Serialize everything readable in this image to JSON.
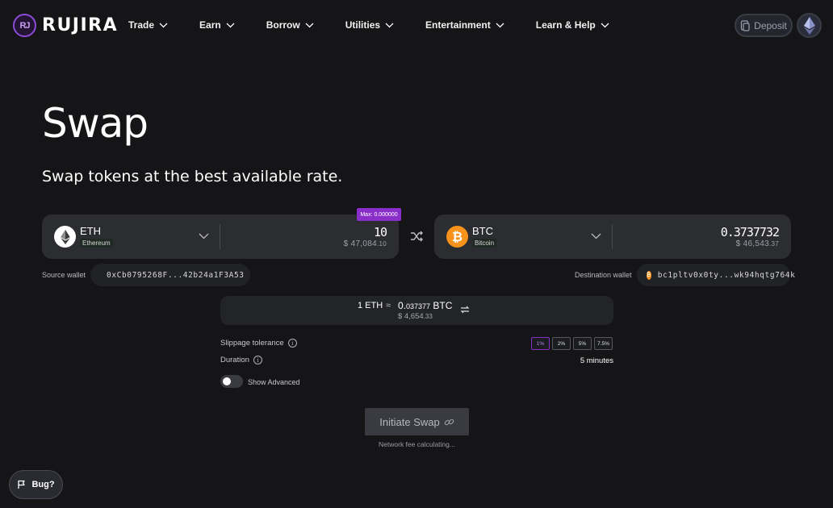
{
  "header": {
    "logo_text": "RUJIRA",
    "logo_mark": "RJ",
    "nav": [
      "Trade",
      "Earn",
      "Borrow",
      "Utilities",
      "Entertainment",
      "Learn & Help"
    ],
    "deposit_label": "Deposit"
  },
  "page": {
    "title": "Swap",
    "subtitle": "Swap tokens at the best available rate."
  },
  "source": {
    "symbol": "ETH",
    "chain": "Ethereum",
    "amount": "10",
    "usd_main": "$ 47,084",
    "usd_dec": ".10",
    "max_label": "Max: 0.000000",
    "wallet_label": "Source wallet",
    "wallet_address": "0xCb0795268F...42b24a1F3A53"
  },
  "destination": {
    "symbol": "BTC",
    "chain": "Bitcoin",
    "amount": "0.3737732",
    "usd_main": "$ 46,543",
    "usd_dec": ".37",
    "wallet_label": "Destination wallet",
    "wallet_address": "bc1pltv0x0ty...wk94hqtg764k"
  },
  "rate": {
    "left": "1 ETH",
    "approx": "≈",
    "right_main": "0.",
    "right_small": "037377",
    "right_symbol": " BTC",
    "usd_main": "$ 4,654",
    "usd_dec": ".33"
  },
  "options": {
    "slippage_label": "Slippage tolerance",
    "slippage_options": [
      "1%",
      "2%",
      "5%",
      "7.5%"
    ],
    "slippage_selected": "1%",
    "duration_label": "Duration",
    "duration_value": "5 minutes",
    "advanced_label": "Show Advanced"
  },
  "action": {
    "initiate_label": "Initiate Swap",
    "fee_text": "Network fee calculating..."
  },
  "bug_label": "Bug?",
  "colors": {
    "background": "#151517",
    "panel": "#2c2d31",
    "accent": "#8a2ec9",
    "eth_icon": "#ffffff",
    "btc_icon": "#f7931a"
  }
}
